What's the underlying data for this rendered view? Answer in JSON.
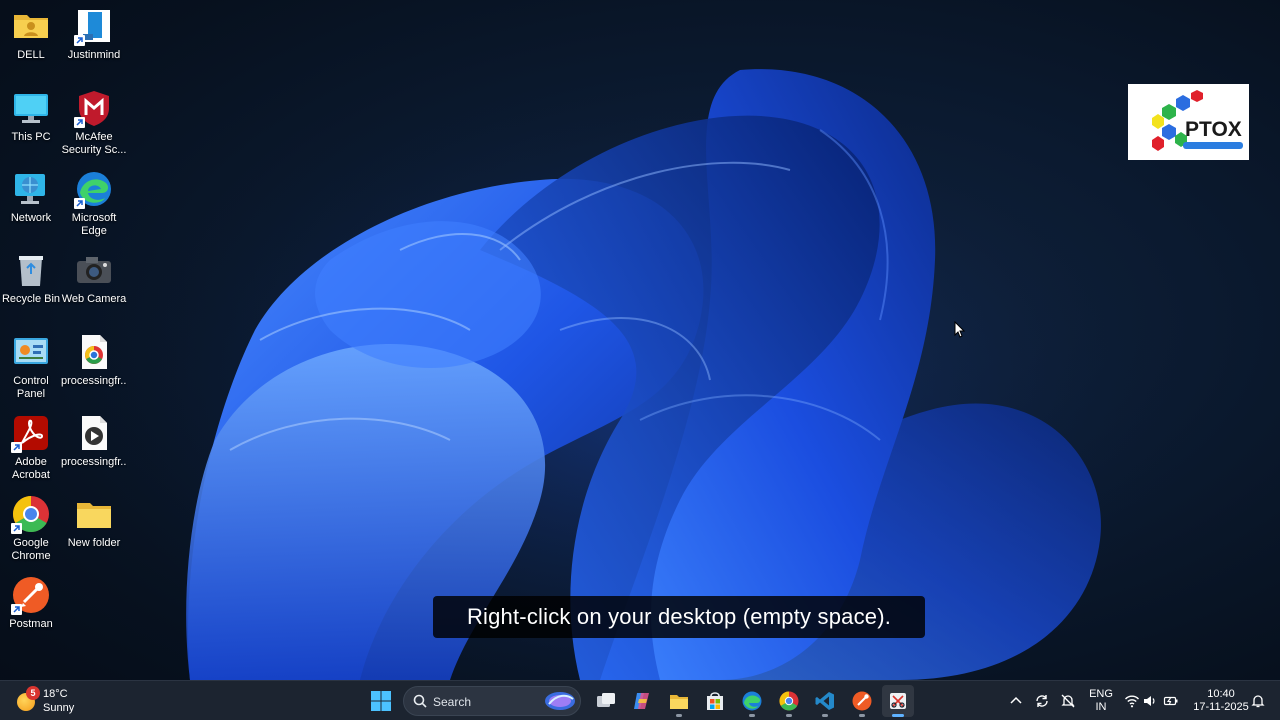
{
  "desktop": {
    "icons": [
      {
        "label": "DELL",
        "icon": "user-folder-icon"
      },
      {
        "label": "Justinmind",
        "icon": "justinmind-icon"
      },
      {
        "label": "This PC",
        "icon": "monitor-icon"
      },
      {
        "label": "McAfee Security Sc...",
        "icon": "mcafee-icon"
      },
      {
        "label": "Network",
        "icon": "network-icon"
      },
      {
        "label": "Microsoft Edge",
        "icon": "edge-icon"
      },
      {
        "label": "Recycle Bin",
        "icon": "recycle-bin-icon"
      },
      {
        "label": "Web Camera",
        "icon": "camera-icon"
      },
      {
        "label": "Control Panel",
        "icon": "control-panel-icon"
      },
      {
        "label": "processingfr...",
        "icon": "chrome-file-icon"
      },
      {
        "label": "Adobe Acrobat",
        "icon": "acrobat-icon"
      },
      {
        "label": "processingfr...",
        "icon": "video-file-icon"
      },
      {
        "label": "Google Chrome",
        "icon": "chrome-icon"
      },
      {
        "label": "New folder",
        "icon": "folder-icon"
      },
      {
        "label": "Postman",
        "icon": "postman-icon"
      }
    ]
  },
  "logo": {
    "text": "PTOX"
  },
  "caption": {
    "text": "Right-click on your desktop (empty space)."
  },
  "taskbar": {
    "weather": {
      "badge": "5",
      "temperature": "18°C",
      "condition": "Sunny"
    },
    "search": {
      "label": "Search"
    },
    "language": {
      "line1": "ENG",
      "line2": "IN"
    },
    "clock": {
      "time": "10:40",
      "date": "17-11-2025"
    }
  },
  "colors": {
    "accent": "#5fb2ff",
    "taskbar": "#1c2430",
    "desktop": "#0b1a30"
  }
}
